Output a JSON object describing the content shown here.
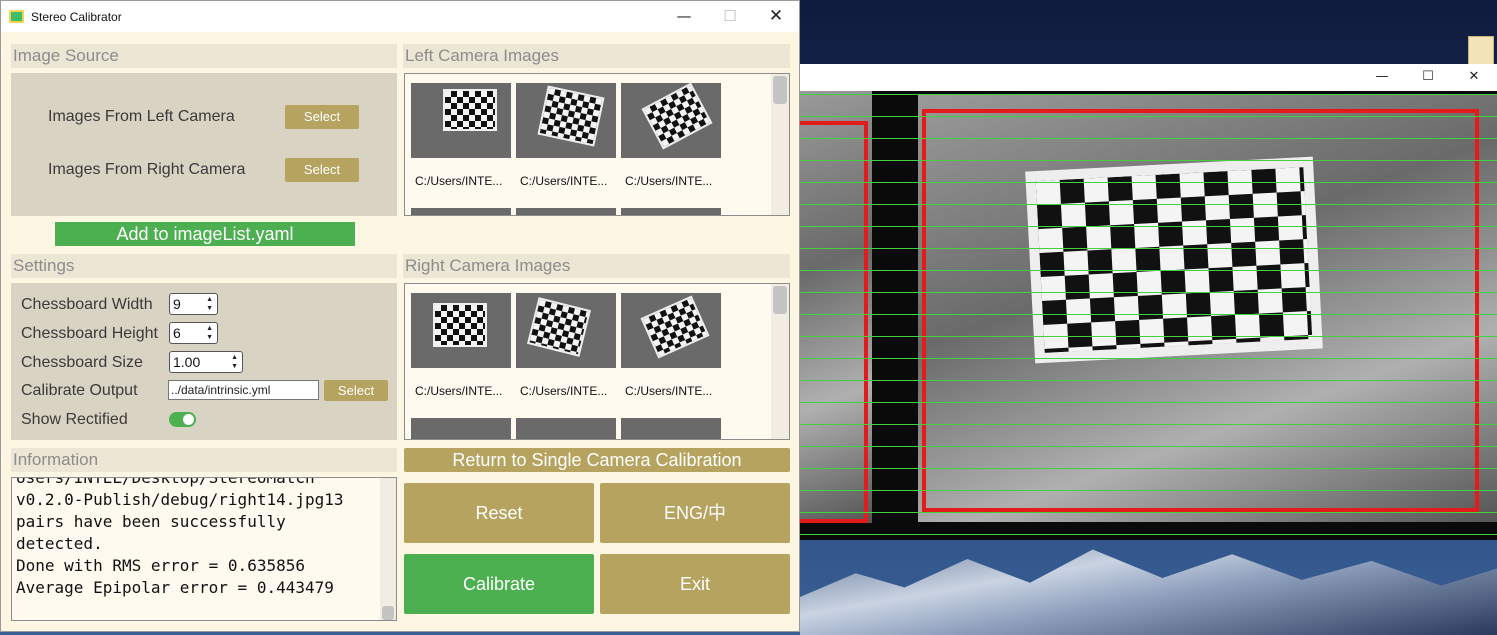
{
  "window": {
    "title": "Stereo Calibrator",
    "controls": {
      "minimize": "—",
      "maximize": "☐",
      "close": "✕"
    }
  },
  "image_source": {
    "header": "Image Source",
    "left_label": "Images From Left Camera",
    "right_label": "Images From Right Camera",
    "select_label": "Select",
    "add_button": "Add to imageList.yaml"
  },
  "settings": {
    "header": "Settings",
    "width_label": "Chessboard Width",
    "width_value": "9",
    "height_label": "Chessboard Height",
    "height_value": "6",
    "size_label": "Chessboard Size",
    "size_value": "1.00",
    "output_label": "Calibrate Output",
    "output_value": "../data/intrinsic.yml",
    "output_select": "Select",
    "rectified_label": "Show Rectified",
    "rectified_on": true
  },
  "left_images": {
    "header": "Left Camera Images",
    "captions": [
      "C:/Users/INTE...",
      "C:/Users/INTE...",
      "C:/Users/INTE..."
    ]
  },
  "right_images": {
    "header": "Right Camera Images",
    "captions": [
      "C:/Users/INTE...",
      "C:/Users/INTE...",
      "C:/Users/INTE..."
    ]
  },
  "return_button": "Return to Single Camera Calibration",
  "actions": {
    "reset": "Reset",
    "lang": "ENG/中",
    "calibrate": "Calibrate",
    "exit": "Exit"
  },
  "information": {
    "header": "Information",
    "log": "Users/INTEL/Desktop/StereoMatch\nv0.2.0-Publish/debug/right14.jpg13\npairs have been successfully\ndetected.\nDone with RMS error = 0.635856\nAverage Epipolar error = 0.443479"
  },
  "colors": {
    "accent_olive": "#b5a35f",
    "accent_green": "#4caf50",
    "epipolar_line": "#3fd43f",
    "roi_box": "#e21b1b"
  },
  "rectified_window": {
    "controls": {
      "minimize": "—",
      "maximize": "☐",
      "close": "✕"
    }
  }
}
